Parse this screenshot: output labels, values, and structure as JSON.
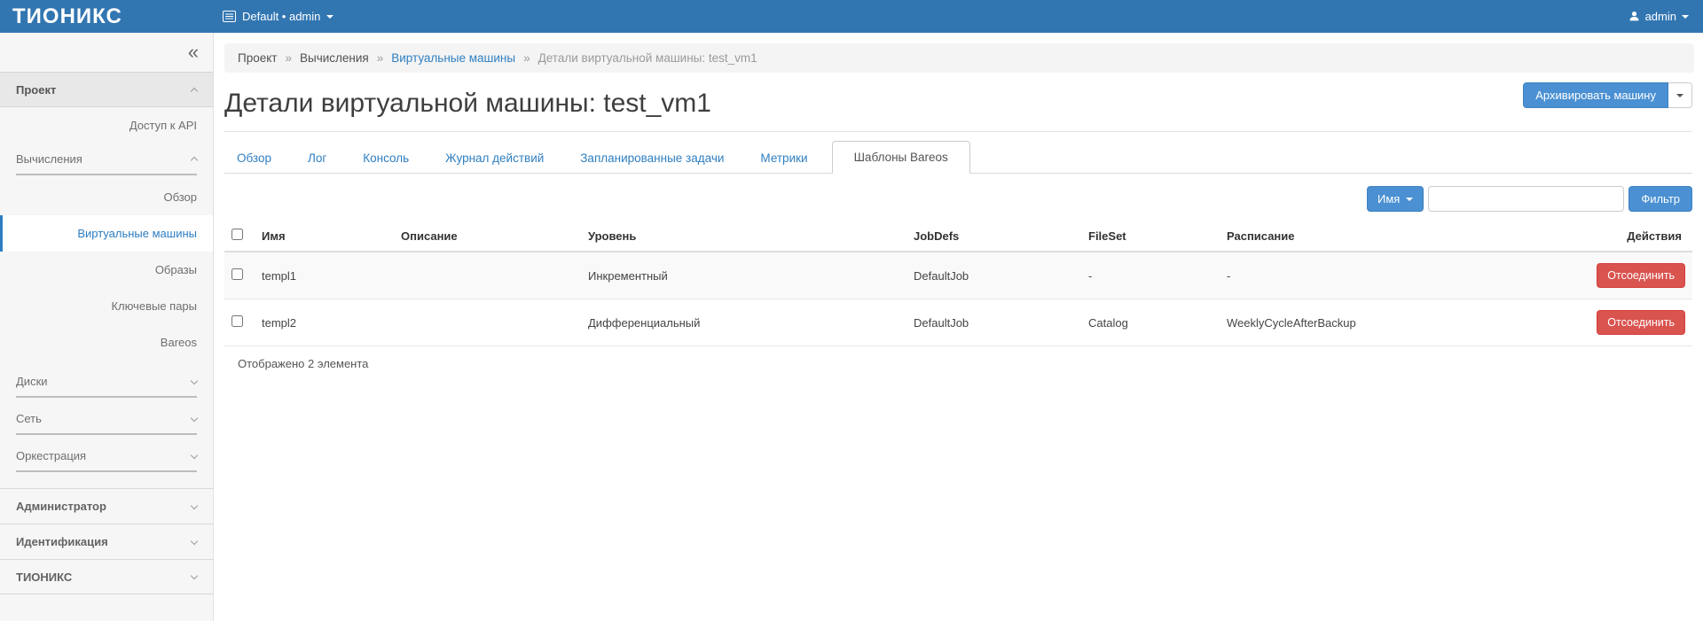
{
  "colors": {
    "topbar_blue": "#3276b1",
    "primary_button_blue": "#4a90d2",
    "link_blue": "#2f7fc1",
    "active_item_blue": "#2d7dc1",
    "danger_red": "#d9534f",
    "sidebar_bg": "#f6f6f6",
    "breadcrumb_bg": "#f4f4f4"
  },
  "topbar": {
    "brand": "ТИОНИКС",
    "context_label": "Default • admin",
    "user_label": "admin"
  },
  "sidebar": {
    "collapse_glyph": "«",
    "panel_project": "Проект",
    "item_api_access": "Доступ к API",
    "group_compute": "Вычисления",
    "compute_items": {
      "overview": "Обзор",
      "instances": "Виртуальные машины",
      "images": "Образы",
      "keypairs": "Ключевые пары",
      "bareos": "Bareos"
    },
    "group_volumes": "Диски",
    "group_network": "Сеть",
    "group_orchestration": "Оркестрация",
    "panel_admin": "Администратор",
    "panel_identity": "Идентификация",
    "panel_tionix": "ТИОНИКС"
  },
  "breadcrumb": {
    "separator": "»",
    "items": [
      "Проект",
      "Вычисления",
      "Виртуальные машины",
      "Детали виртуальной машины: test_vm1"
    ]
  },
  "page": {
    "title": "Детали виртуальной машины: test_vm1"
  },
  "actions": {
    "archive": "Архивировать машину"
  },
  "tabs": [
    "Обзор",
    "Лог",
    "Консоль",
    "Журнал действий",
    "Запланированные задачи",
    "Метрики",
    "Шаблоны Bareos"
  ],
  "filter": {
    "field": "Имя",
    "placeholder": "",
    "submit": "Фильтр"
  },
  "table": {
    "columns": [
      "Имя",
      "Описание",
      "Уровень",
      "JobDefs",
      "FileSet",
      "Расписание",
      "Действия"
    ],
    "rows": [
      {
        "name": "templ1",
        "description": "",
        "level": "Инкрементный",
        "jobdefs": "DefaultJob",
        "fileset": "-",
        "schedule": "-",
        "action": "Отсоединить"
      },
      {
        "name": "templ2",
        "description": "",
        "level": "Дифференциальный",
        "jobdefs": "DefaultJob",
        "fileset": "Catalog",
        "schedule": "WeeklyCycleAfterBackup",
        "action": "Отсоединить"
      }
    ],
    "footer": "Отображено 2 элемента"
  }
}
